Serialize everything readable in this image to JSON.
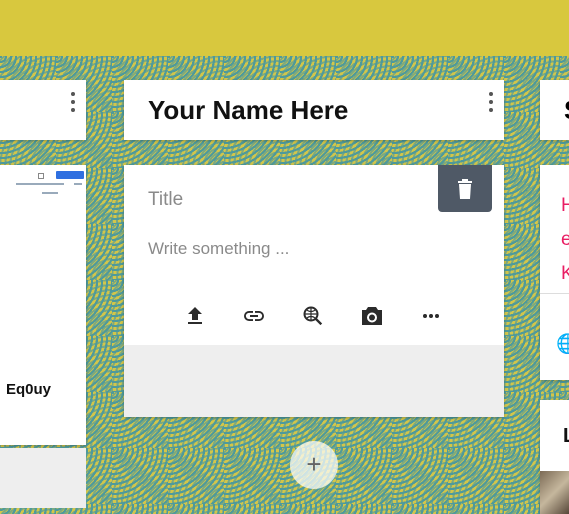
{
  "board": {
    "add_button_label": "+"
  },
  "columns": [
    {
      "header": "",
      "post": {
        "title": "Eq0uy"
      }
    },
    {
      "header": "Your Name Here",
      "composer": {
        "title_placeholder": "Title",
        "body_placeholder": "Write something ...",
        "tools": [
          "upload-icon",
          "link-icon",
          "web-search-icon",
          "camera-icon",
          "more-icon"
        ]
      }
    },
    {
      "header": "S",
      "post_text_lines": [
        "H",
        "e",
        "K"
      ],
      "post2_title": "L"
    }
  ],
  "colors": {
    "accent_bar": "#d8c83e",
    "pattern_yellow": "#d2c64a",
    "pattern_teal": "#4f9a9b",
    "delete_button": "#4f5966",
    "link_text": "#e91e63"
  }
}
